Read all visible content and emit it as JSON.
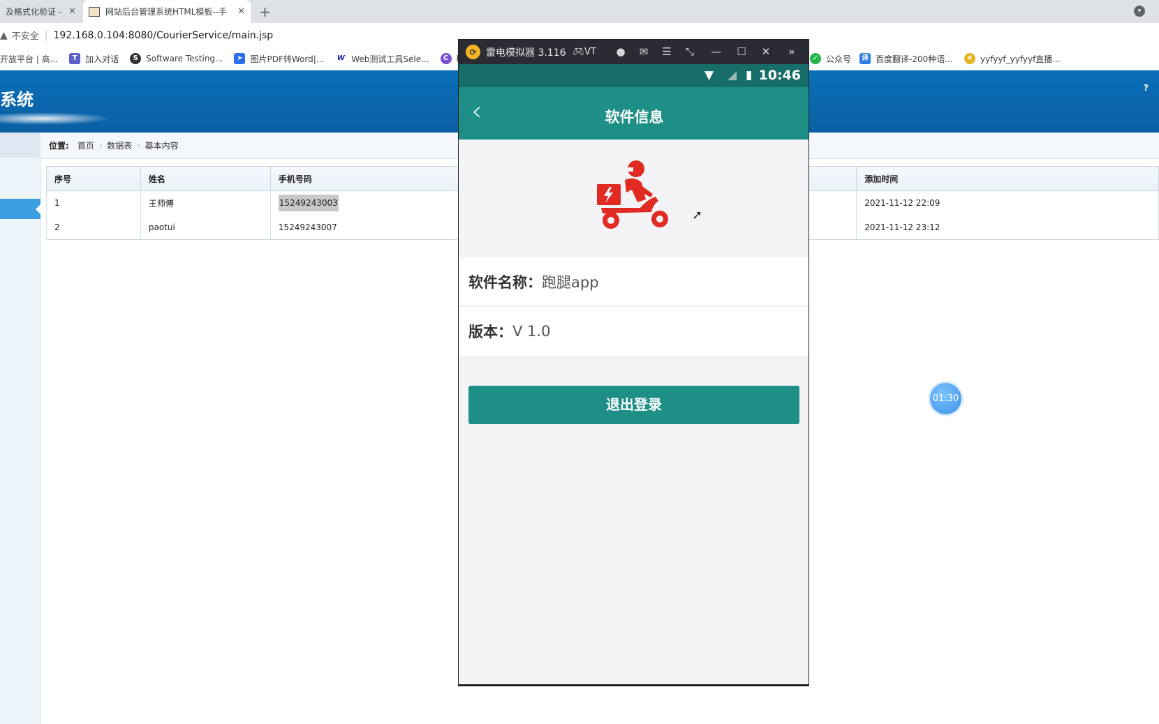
{
  "browser": {
    "tabs": [
      {
        "title": "及格式化验证 - JS",
        "close": "✕"
      },
      {
        "title": "网站后台管理系统HTML模板--手",
        "close": "✕"
      }
    ],
    "new_tab": "+",
    "security_label": "不安全",
    "url": "192.168.0.104:8080/CourierService/main.jsp",
    "bookmarks": [
      {
        "label": "开放平台 | 高...",
        "icon_color": "#ffffff"
      },
      {
        "label": "加入对话",
        "icon_color": "#5b5fc7"
      },
      {
        "label": "Software Testing...",
        "icon_color": "#333333"
      },
      {
        "label": "图片PDF转Word|...",
        "icon_color": "#2a6ff0"
      },
      {
        "label": "Web测试工具Sele...",
        "icon_color": "#1a1aa8"
      },
      {
        "label": "Ic",
        "icon_color": "#7a4fd6"
      },
      {
        "label": "公众号",
        "icon_color": "#27b44a"
      },
      {
        "label": "百度翻译-200种语...",
        "icon_color": "#2c7be5"
      },
      {
        "label": "yyfyyf_yyfyyf直播...",
        "icon_color": "#e6b422"
      }
    ]
  },
  "admin": {
    "title": "系统",
    "help": "?",
    "breadcrumb": {
      "label": "位置:",
      "items": [
        "首页",
        "数据表",
        "基本内容"
      ],
      "separator": "›"
    },
    "table": {
      "headers": [
        "序号",
        "姓名",
        "手机号码",
        "添加时间"
      ],
      "rows": [
        {
          "no": "1",
          "name": "王师傅",
          "phone": "15249243003",
          "time": "2021-11-12 22:09"
        },
        {
          "no": "2",
          "name": "paotui",
          "phone": "15249243007",
          "time": "2021-11-12 23:12"
        }
      ]
    },
    "timer": "01:30"
  },
  "emulator": {
    "window_title": "雷电模拟器 3.116",
    "vt_label": "VT",
    "status_time": "10:46",
    "app": {
      "toolbar_title": "软件信息",
      "back_icon": "back-chevron-icon",
      "logo_icon": "delivery-scooter-icon",
      "logo_color": "#e02a22",
      "software_name_label": "软件名称：",
      "software_name_value": "跑腿app",
      "version_label": "版本：",
      "version_value": "V 1.0",
      "logout_label": "退出登录"
    },
    "accent_color": "#1e8f86"
  }
}
